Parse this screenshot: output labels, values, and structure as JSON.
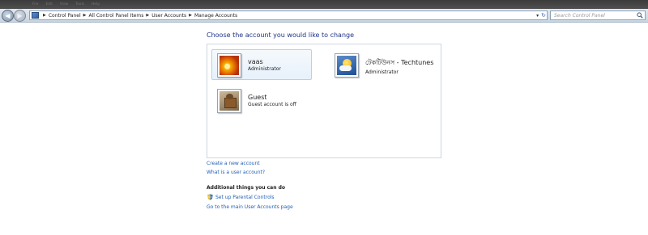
{
  "menu_ghost": [
    "File",
    "Edit",
    "View",
    "Tools",
    "Help"
  ],
  "nav": {
    "back_icon": "back-arrow-icon",
    "forward_icon": "forward-arrow-icon",
    "breadcrumbs": [
      "Control Panel",
      "All Control Panel Items",
      "User Accounts",
      "Manage Accounts"
    ],
    "search_placeholder": "Search Control Panel"
  },
  "main": {
    "heading": "Choose the account you would like to change",
    "accounts": [
      {
        "name": "vaas",
        "role": "Administrator",
        "icon": "flower-avatar-icon"
      },
      {
        "name": "টেকটিউনস - Techtunes",
        "role": "Administrator",
        "icon": "weather-avatar-icon"
      },
      {
        "name": "Guest",
        "role": "Guest account is off",
        "icon": "briefcase-avatar-icon"
      }
    ],
    "create_link": "Create a new account",
    "what_link": "What is a user account?",
    "additional_heading": "Additional things you can do",
    "parental_link": "Set up Parental Controls",
    "main_page_link": "Go to the main User Accounts page"
  },
  "colors": {
    "heading": "#1e3287",
    "link": "#1f5fb5",
    "selected_tile": "#e7f1fb"
  }
}
